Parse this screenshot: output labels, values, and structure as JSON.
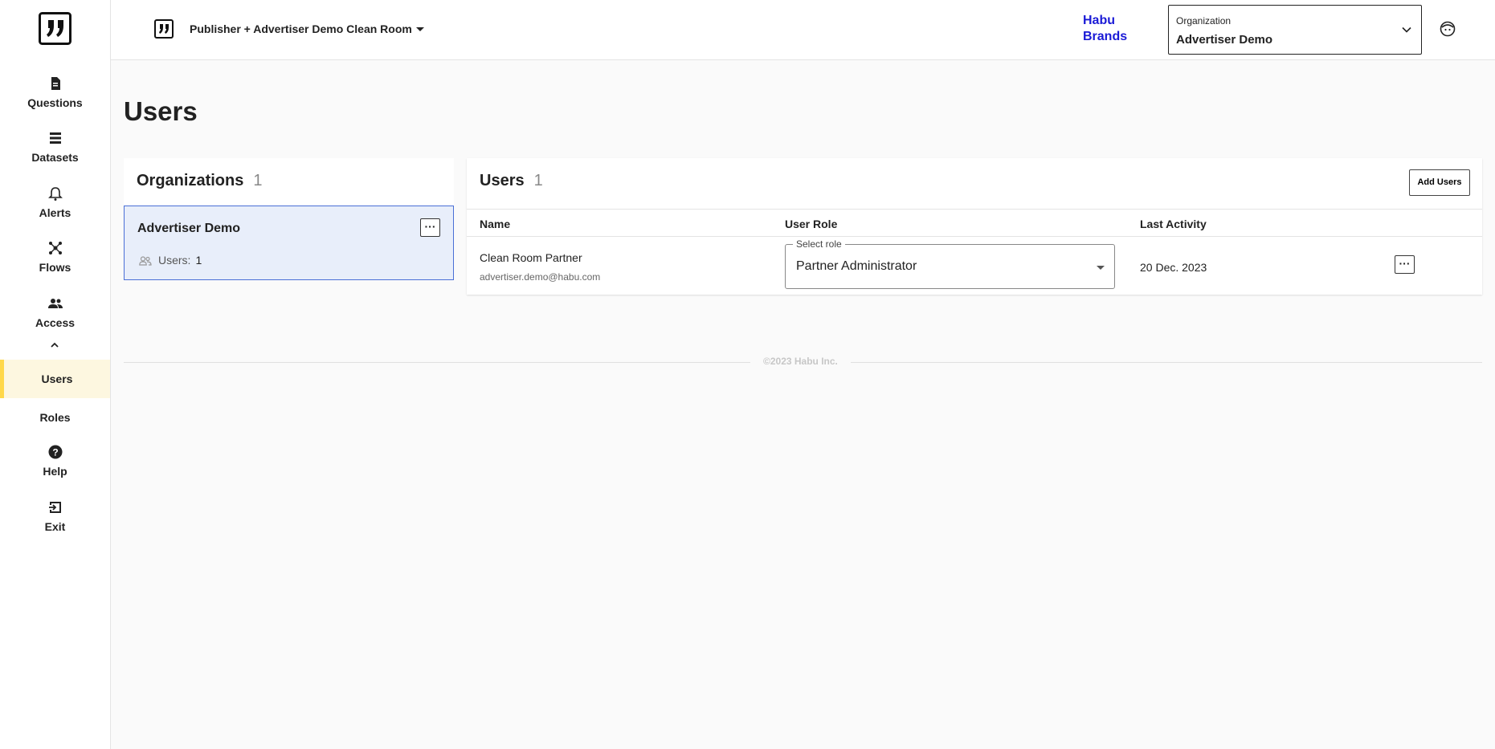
{
  "nav": {
    "items": [
      {
        "label": "Questions",
        "icon": "document-icon"
      },
      {
        "label": "Datasets",
        "icon": "list-icon"
      },
      {
        "label": "Alerts",
        "icon": "bell-icon"
      },
      {
        "label": "Flows",
        "icon": "flows-icon"
      },
      {
        "label": "Access",
        "icon": "people-icon"
      }
    ],
    "sub": [
      {
        "label": "Users",
        "active": true
      },
      {
        "label": "Roles",
        "active": false
      }
    ],
    "help": "Help",
    "exit": "Exit"
  },
  "topbar": {
    "clean_room": "Publisher + Advertiser Demo Clean Room",
    "brand": "Habu Brands",
    "org_select_label": "Organization",
    "org_select_value": "Advertiser Demo"
  },
  "page": {
    "title": "Users"
  },
  "orgs": {
    "title": "Organizations",
    "count": "1",
    "items": [
      {
        "name": "Advertiser Demo",
        "users_label": "Users:",
        "users_count": "1"
      }
    ]
  },
  "users": {
    "title": "Users",
    "count": "1",
    "add_label": "Add Users",
    "columns": [
      "Name",
      "User Role",
      "Last Activity"
    ],
    "rows": [
      {
        "name": "Clean Room Partner",
        "email": "advertiser.demo@habu.com",
        "role_legend": "Select role",
        "role": "Partner Administrator",
        "last_activity": "20 Dec. 2023"
      }
    ]
  },
  "footer": "©2023 Habu Inc.",
  "colors": {
    "accent_yellow": "#ffd84a",
    "brand_blue": "#1a1ad6",
    "selected_bg": "#e8eefa"
  }
}
